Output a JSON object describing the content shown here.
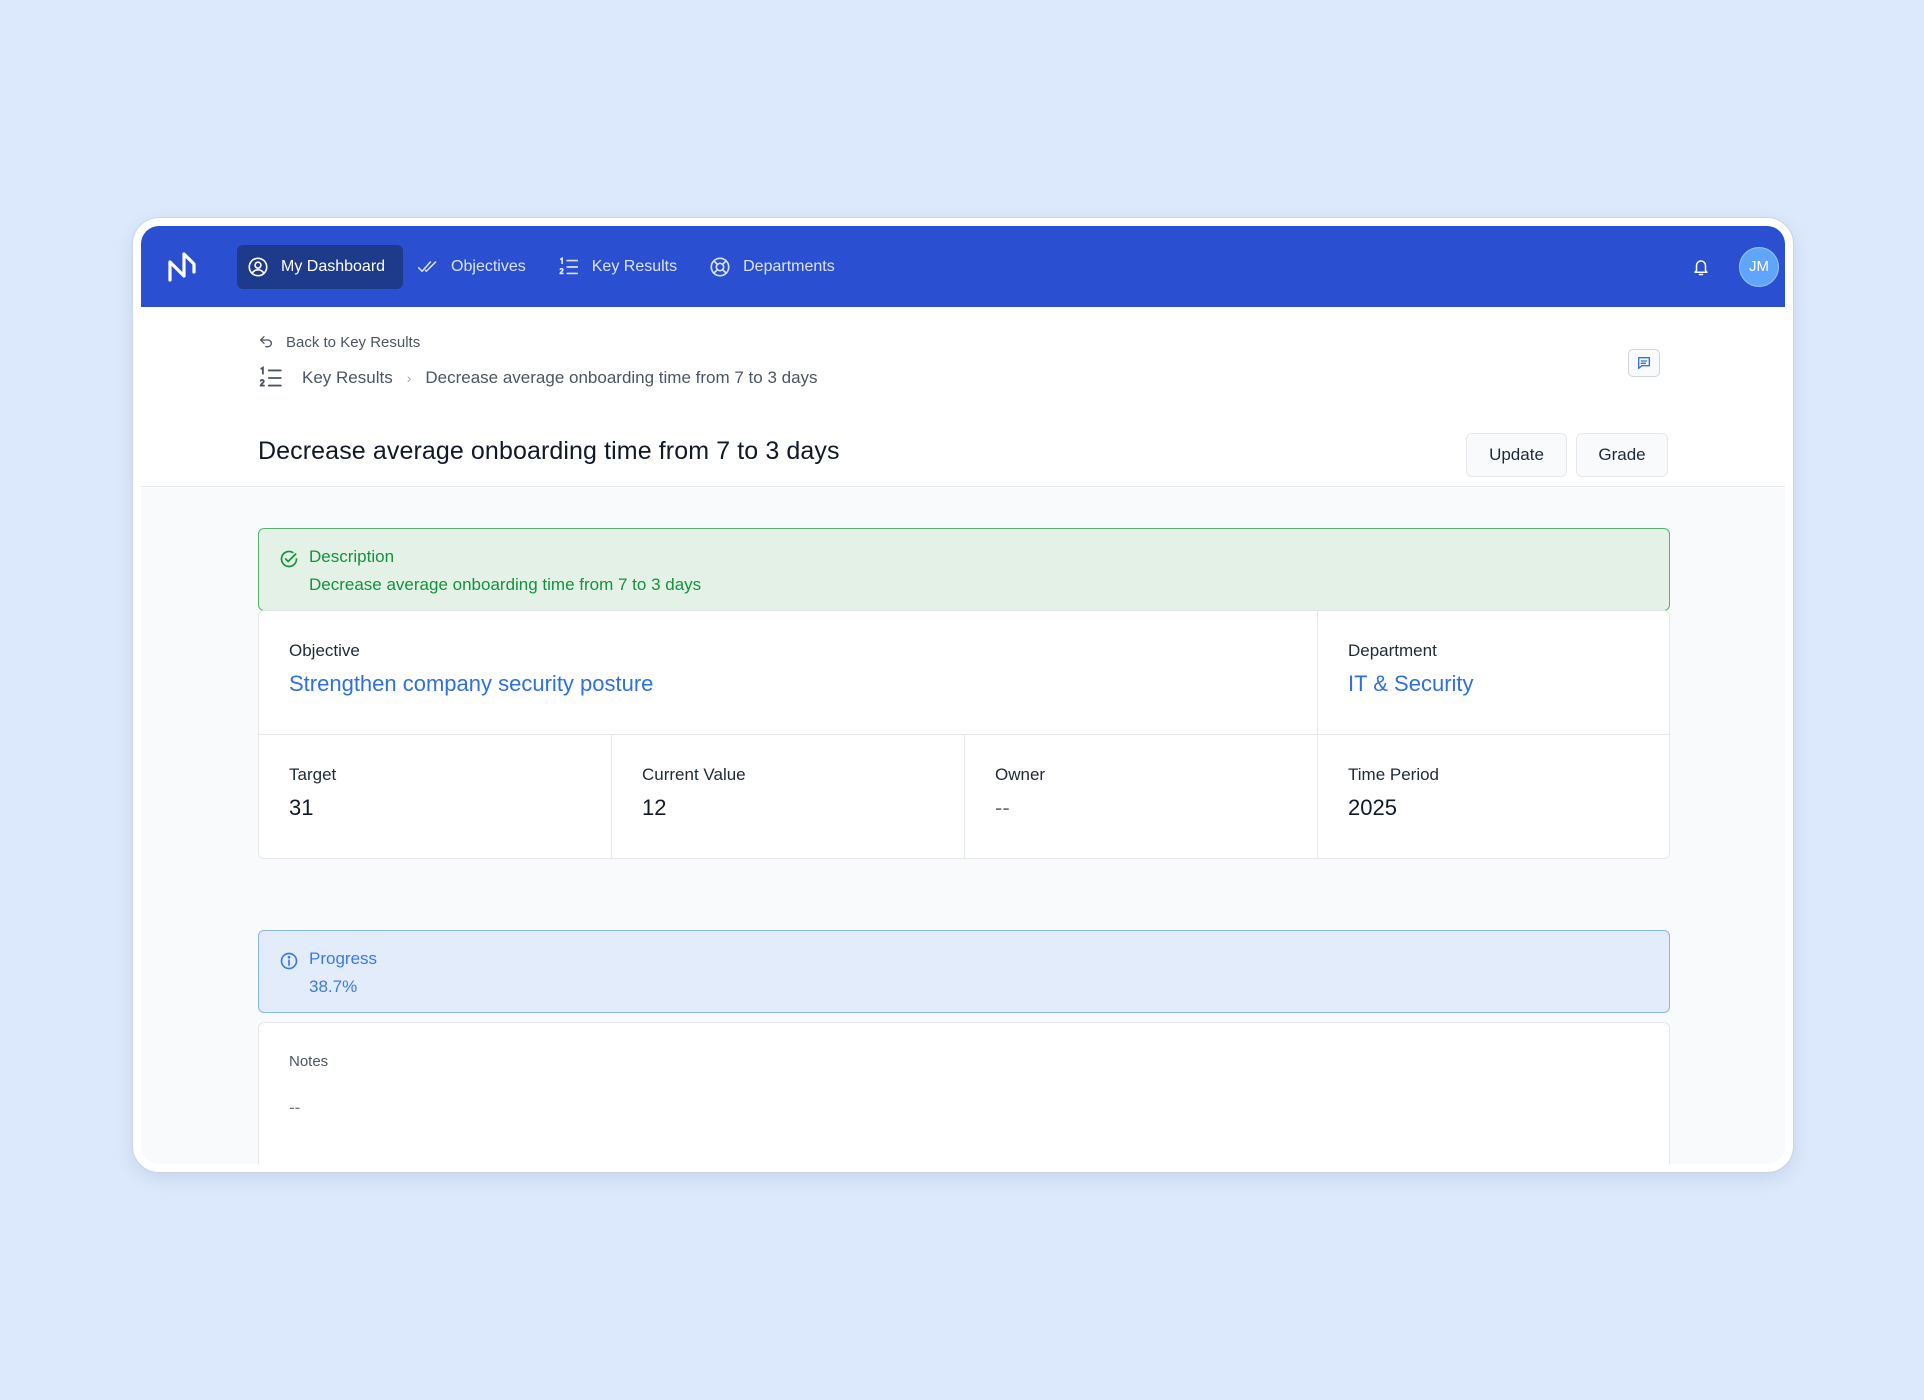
{
  "nav": {
    "items": [
      {
        "label": "My Dashboard",
        "icon": "user-circle-icon",
        "active": true
      },
      {
        "label": "Objectives",
        "icon": "double-check-icon"
      },
      {
        "label": "Key Results",
        "icon": "numbered-list-icon"
      },
      {
        "label": "Departments",
        "icon": "lifebuoy-icon"
      }
    ],
    "avatar_initials": "JM"
  },
  "header": {
    "back_label": "Back to Key Results",
    "breadcrumb": [
      "Key Results",
      "Decrease average onboarding time from 7 to 3 days"
    ],
    "title": "Decrease average onboarding time from 7 to 3 days",
    "update_label": "Update",
    "grade_label": "Grade"
  },
  "description": {
    "title": "Description",
    "text": "Decrease average onboarding time from 7 to 3 days"
  },
  "details": {
    "objective_label": "Objective",
    "objective_value": "Strengthen company security posture",
    "department_label": "Department",
    "department_value": "IT & Security",
    "target_label": "Target",
    "target_value": "31",
    "current_label": "Current Value",
    "current_value": "12",
    "owner_label": "Owner",
    "owner_value": "--",
    "period_label": "Time Period",
    "period_value": "2025"
  },
  "progress": {
    "title": "Progress",
    "value": "38.7%"
  },
  "notes": {
    "label": "Notes",
    "value": "--"
  },
  "colors": {
    "nav_bg": "#2a4fd1",
    "nav_active": "#1e3a8a",
    "success": "#15913f",
    "info": "#3b7ae6",
    "link": "#2f6fe4",
    "page_bg": "#dce9fc"
  }
}
